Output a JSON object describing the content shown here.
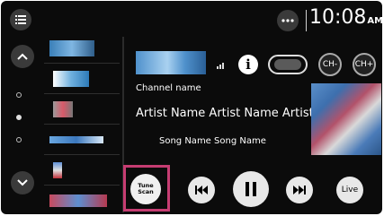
{
  "status_bar": {
    "time": "10:08",
    "ampm": "AM"
  },
  "now_playing": {
    "channel_name": "Channel name",
    "artist": "Artist Name Artist Name Artist",
    "song": "Song Name Song Name"
  },
  "buttons": {
    "ch_minus": "CH-",
    "ch_plus": "CH+",
    "info": "i",
    "tune_scan_line1": "Tune",
    "tune_scan_line2": "Scan",
    "live": "Live"
  },
  "colors": {
    "accent_highlight": "#c63d72",
    "background": "#0b0b0b"
  },
  "icons": [
    "menu-icon",
    "chevron-up-icon",
    "chevron-down-icon",
    "more-icon",
    "signal-icon",
    "info-icon",
    "previous-icon",
    "pause-icon",
    "next-icon"
  ]
}
